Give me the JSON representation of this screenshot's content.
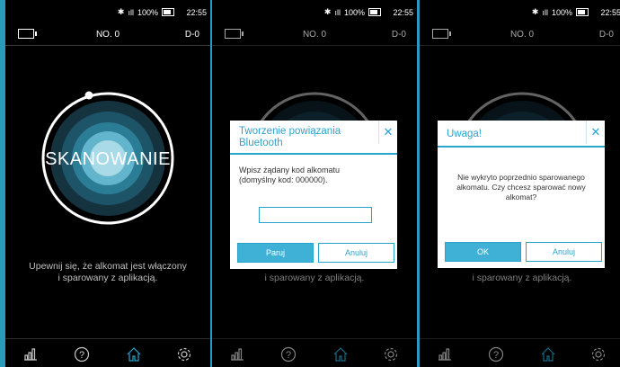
{
  "status_bar": {
    "battery_text": "100%",
    "time": "22:55"
  },
  "header": {
    "device_no": "NO. 0",
    "day": "D-0"
  },
  "screen1": {
    "scan_label": "SKANOWANIE",
    "description_line1": "Upewnij się, że alkomat jest włączony",
    "description_line2": "i sparowany z aplikacją."
  },
  "screen2": {
    "dialog_title": "Tworzenie powiązania Bluetooth",
    "prompt_line1": "Wpisz żądany kod alkomatu",
    "prompt_line2": "(domyślny kod: 000000).",
    "pin_value": "",
    "pair_button": "Paruj",
    "cancel_button": "Anuluj",
    "bg_description": "i sparowany z aplikacją."
  },
  "screen3": {
    "dialog_title": "Uwaga!",
    "message_line1": "Nie wykryto poprzednio sparowanego",
    "message_line2": "alkomatu. Czy chcesz sparować nowy",
    "message_line3": "alkomat?",
    "ok_button": "OK",
    "cancel_button": "Anuluj",
    "bg_description": "i sparowany z aplikacją."
  },
  "nav_icons": [
    "bar-chart-icon",
    "help-icon",
    "home-icon",
    "gear-icon"
  ],
  "colors": {
    "accent": "#2aa3cc",
    "background": "#000000",
    "frame": "#2a9bbd"
  }
}
